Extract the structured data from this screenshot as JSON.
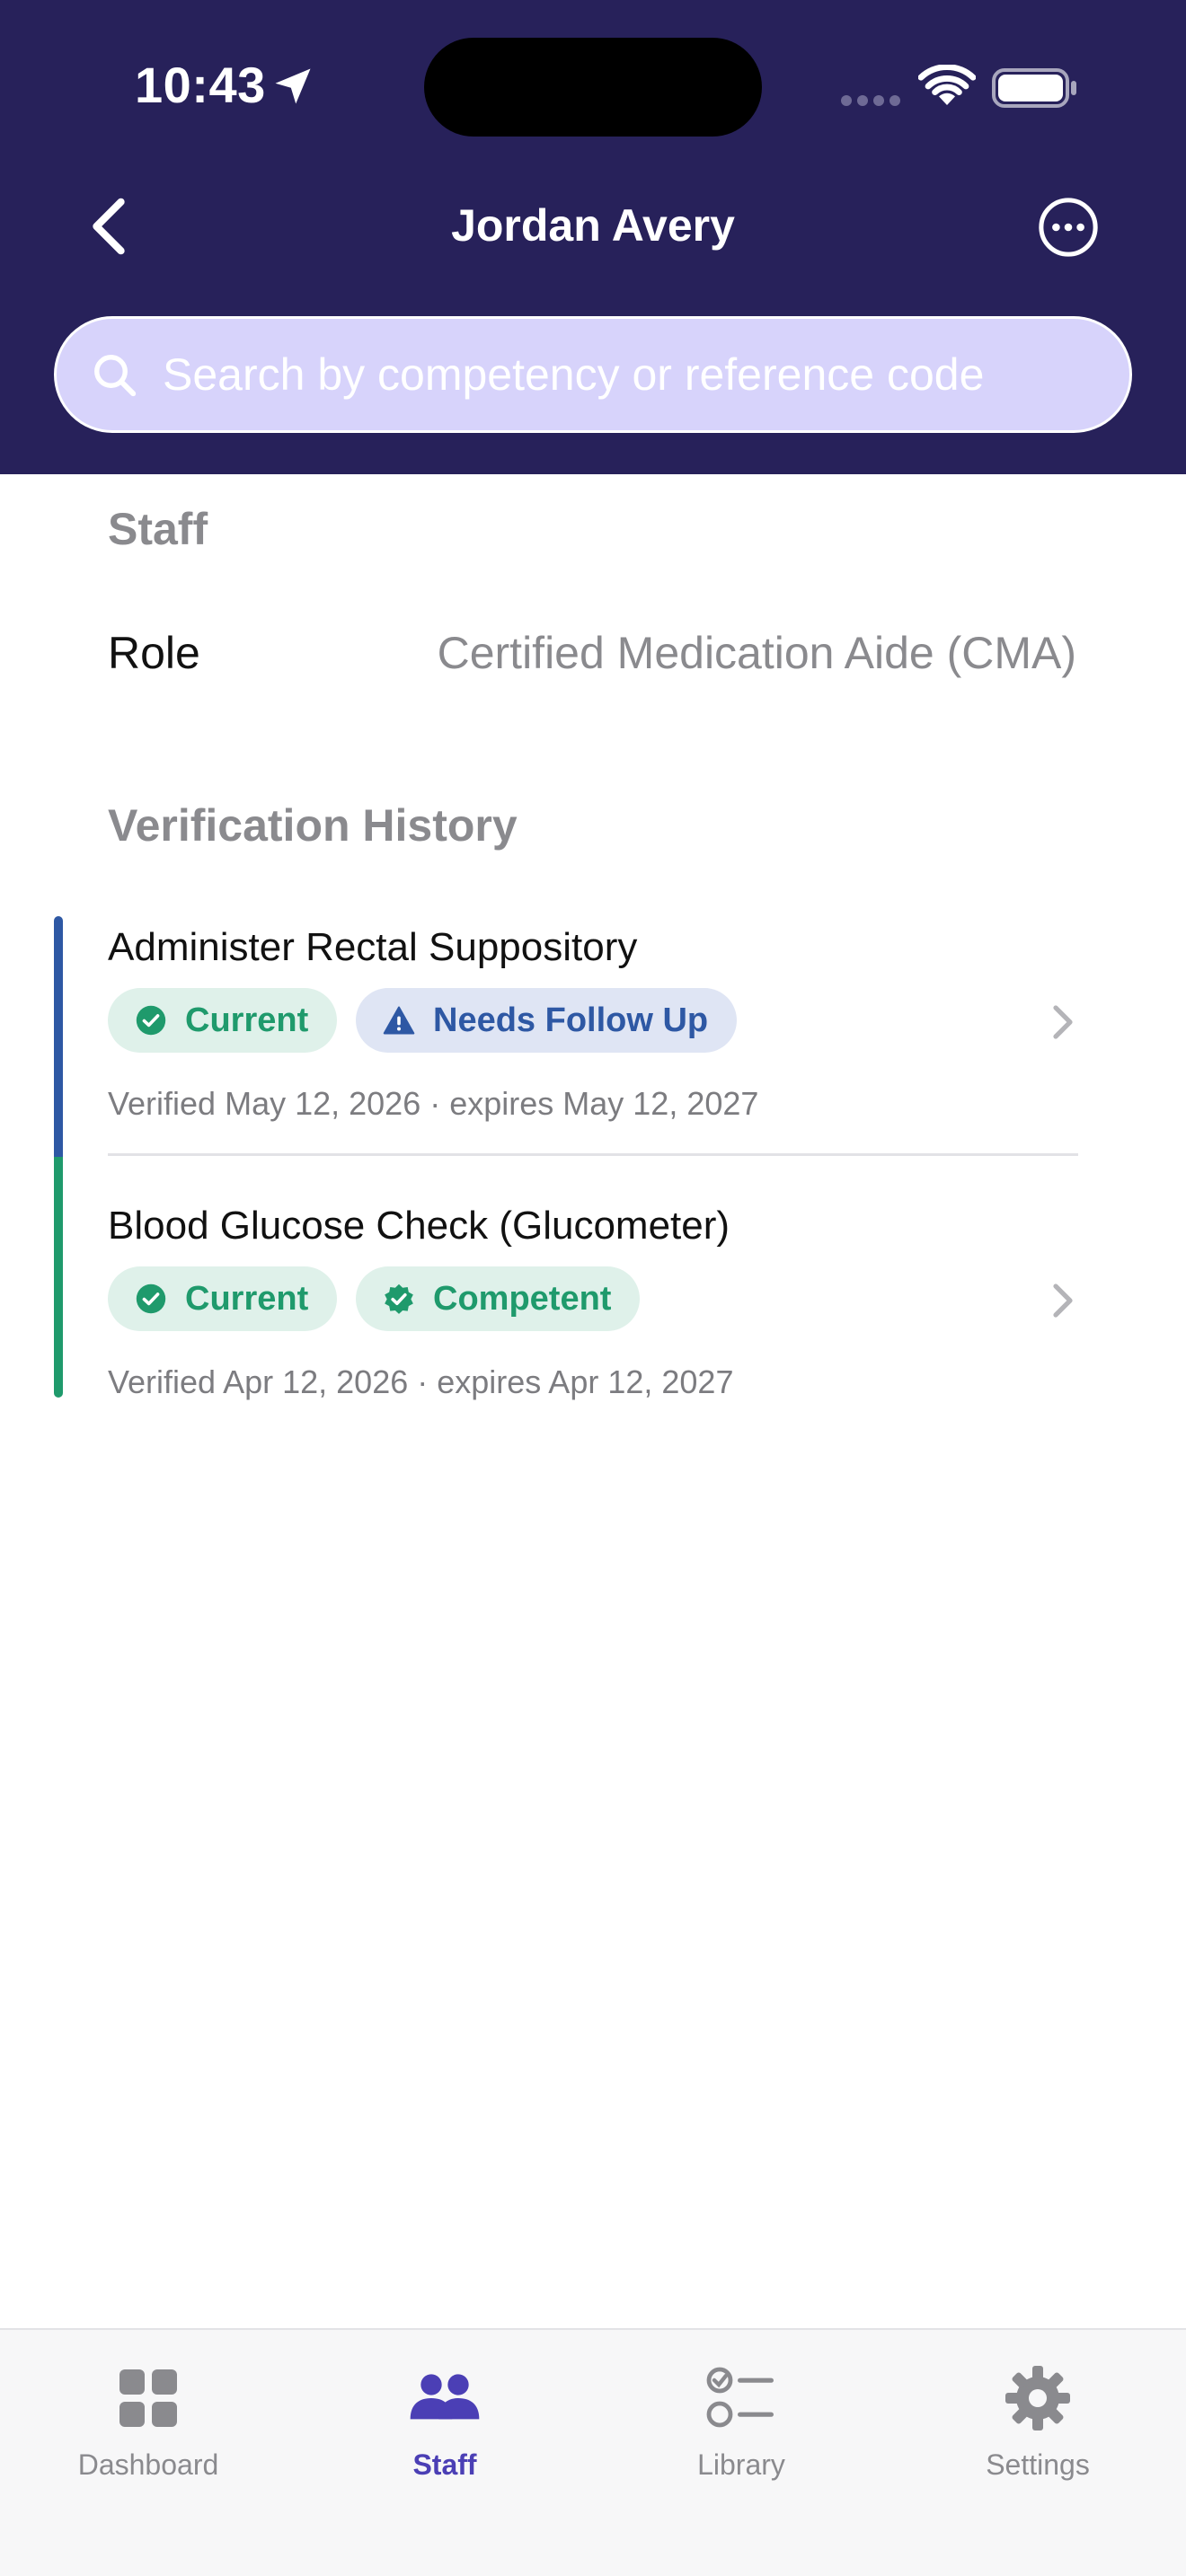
{
  "status_bar": {
    "time": "10:43"
  },
  "nav": {
    "title": "Jordan Avery"
  },
  "search": {
    "placeholder": "Search by competency or reference code"
  },
  "staff_section": {
    "title": "Staff",
    "role_label": "Role",
    "role_value": "Certified Medication Aide (CMA)"
  },
  "history": {
    "title": "Verification History",
    "items": [
      {
        "title": "Administer Rectal Suppository",
        "status_chip": "Current",
        "result_chip": "Needs Follow Up",
        "subtitle": "Verified May 12, 2026 · expires May 12, 2027"
      },
      {
        "title": "Blood Glucose Check (Glucometer)",
        "status_chip": "Current",
        "result_chip": "Competent",
        "subtitle": "Verified Apr 12, 2026 · expires Apr 12, 2027"
      }
    ]
  },
  "tabbar": {
    "tabs": [
      {
        "label": "Dashboard",
        "icon": "grid-icon"
      },
      {
        "label": "Staff",
        "icon": "people-icon",
        "active": true
      },
      {
        "label": "Library",
        "icon": "checklist-icon"
      },
      {
        "label": "Settings",
        "icon": "gear-icon"
      }
    ]
  },
  "colors": {
    "header_bg": "#27215a",
    "search_bg": "#d7d3fb",
    "accent": "#4b3fb5",
    "green": "#1f9a6c",
    "blue": "#2e58a4"
  }
}
